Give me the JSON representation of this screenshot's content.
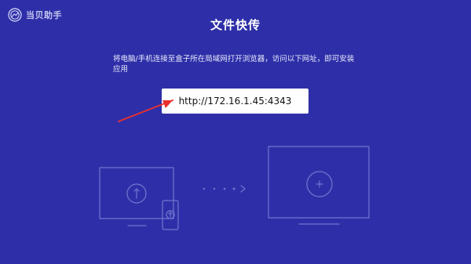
{
  "brand": {
    "logo_text": "当贝助手",
    "logo_icon": "dangbei-logo-icon"
  },
  "page": {
    "title": "文件快传",
    "instruction": "将电脑/手机连接至盒子所在局域网打开浏览器，访问以下网址，即可安装应用",
    "url": "http://172.16.1.45:4343"
  },
  "colors": {
    "background": "#2e2fa8",
    "outline": "#6f76cf",
    "arrow": "#e8302f",
    "url_box": "#ffffff"
  },
  "illustration": {
    "source_device_icons": [
      "monitor-icon",
      "phone-icon",
      "upload-arrow-icon"
    ],
    "flow_icon": "chevron-right-icon",
    "target_device_icons": [
      "tv-icon",
      "plus-icon"
    ]
  }
}
